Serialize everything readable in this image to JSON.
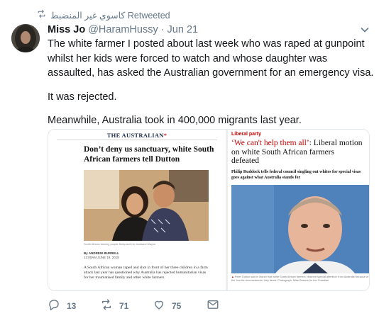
{
  "retweet": {
    "label": "كاسوي غير المنضبط Retweeted"
  },
  "tweet": {
    "name": "Miss Jo",
    "handle": "@HaramHussy",
    "dot": "·",
    "date": "Jun 21",
    "paragraphs": [
      "The white farmer I posted about last week who was raped at gunpoint whilst her kids were forced to watch and whose daughter was assaulted, has asked the Australian government for an emergency visa.",
      "It was rejected.",
      "Meanwhile, Australia took in 400,000 migrants last year."
    ]
  },
  "media": {
    "left": {
      "logo": "THE AUSTRALIAN",
      "logo_star": "*",
      "headline": "Don’t deny us sanctuary, white South African farmers tell Dutton",
      "caption": "South African farming couple Nicky and her husband Wayne.",
      "byline_by": "By ANDREW BURRELL",
      "byline_date": "12:00AM JUNE 19, 2018",
      "summary": "A South African woman raped and shot in front of her three children in a farm attack last year has questioned why Australia has rejected humanitarian visas for her traumatised family and other white farmers."
    },
    "right": {
      "section": "Liberal party",
      "headline_quote": "‘We can't help them all’",
      "headline_line1_rest": ": Liberal motion",
      "headline_line2": "on white South African farmers",
      "headline_line3": "defeated",
      "standfirst": "Philip Ruddock tells federal council singling out whites for special visas goes against what Australia stands for",
      "caption_marker": "▲",
      "caption": "Peter Dutton said in March that white South African farmers ‘deserve special attention’ from Australia because of the ‘horrific circumstances’ they faced. Photograph: Mike Bowers for the Guardian"
    }
  },
  "actions": {
    "replies": "13",
    "retweets": "71",
    "likes": "75"
  },
  "icons": {
    "retweet": "retweet-icon",
    "reply": "reply-icon",
    "like": "heart-icon",
    "dm": "envelope-icon",
    "caret": "chevron-down-icon"
  },
  "colors": {
    "text": "#14171a",
    "secondary": "#657786",
    "guardian_red": "#c70000"
  }
}
